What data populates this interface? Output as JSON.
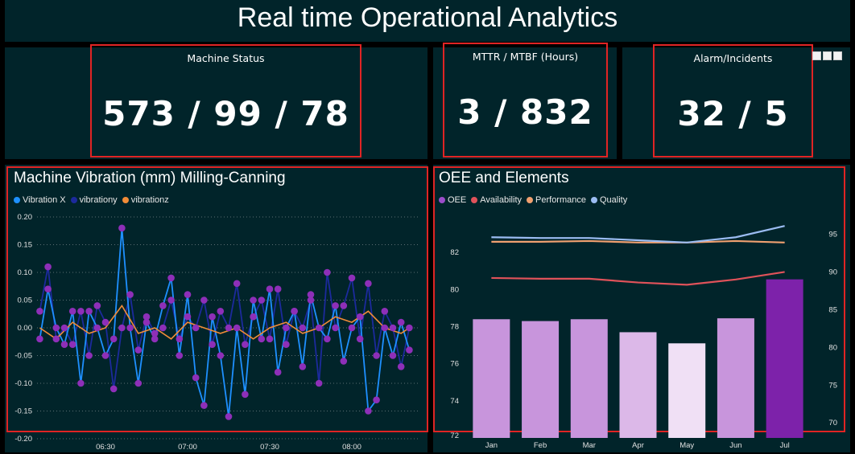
{
  "page_title": "Real time Operational Analytics",
  "kpis": [
    {
      "label": "Machine Status",
      "value": "573 / 99 / 78"
    },
    {
      "label": "MTTR / MTBF (Hours)",
      "value": "3 / 832"
    },
    {
      "label": "Alarm/Incidents",
      "value": "32 / 5"
    }
  ],
  "header_icons": [
    "filter-icon",
    "focus-mode-icon",
    "more-options-icon"
  ],
  "chart_data": [
    {
      "type": "line",
      "title": "Machine Vibration (mm) Milling-Canning",
      "x_ticks": [
        "06:30",
        "07:00",
        "07:30",
        "08:00"
      ],
      "ylim": [
        -0.2,
        0.2
      ],
      "y_ticks": [
        -0.2,
        -0.15,
        -0.1,
        -0.05,
        0.0,
        0.05,
        0.1,
        0.15,
        0.2
      ],
      "y_tick_labels": [
        "-0.20",
        "-0.15",
        "-0.10",
        "-0.05",
        "0.00",
        "0.05",
        "0.10",
        "0.15",
        "0.20"
      ],
      "grid": true,
      "legend": "top-left",
      "x_range": [
        "06:05",
        "08:25"
      ],
      "series": [
        {
          "name": "Vibration X",
          "color": "#1e90ff",
          "x": [
            "06:06",
            "06:09",
            "06:12",
            "06:15",
            "06:18",
            "06:21",
            "06:24",
            "06:27",
            "06:30",
            "06:33",
            "06:36",
            "06:39",
            "06:42",
            "06:45",
            "06:48",
            "06:51",
            "06:54",
            "06:57",
            "07:00",
            "07:03",
            "07:06",
            "07:09",
            "07:12",
            "07:15",
            "07:18",
            "07:21",
            "07:24",
            "07:27",
            "07:30",
            "07:33",
            "07:36",
            "07:39",
            "07:42",
            "07:45",
            "07:48",
            "07:51",
            "07:54",
            "07:57",
            "08:00",
            "08:03",
            "08:06",
            "08:09",
            "08:12",
            "08:15",
            "08:18",
            "08:21"
          ],
          "values": [
            -0.02,
            0.07,
            0.0,
            -0.03,
            0.03,
            -0.1,
            0.03,
            0.0,
            -0.05,
            -0.02,
            0.18,
            0.0,
            -0.1,
            0.01,
            -0.02,
            0.04,
            0.09,
            -0.05,
            0.06,
            -0.09,
            -0.14,
            0.02,
            -0.05,
            -0.16,
            0.0,
            -0.12,
            0.05,
            -0.02,
            0.07,
            -0.08,
            0.0,
            0.03,
            -0.07,
            0.06,
            0.0,
            -0.02,
            0.04,
            -0.06,
            0.0,
            0.02,
            -0.15,
            -0.13,
            0.0,
            -0.05,
            0.01,
            -0.04
          ]
        },
        {
          "name": "vibrationy",
          "color": "#1c2a9c",
          "x": [
            "06:06",
            "06:09",
            "06:12",
            "06:15",
            "06:18",
            "06:21",
            "06:24",
            "06:27",
            "06:30",
            "06:33",
            "06:36",
            "06:39",
            "06:42",
            "06:45",
            "06:48",
            "06:51",
            "06:54",
            "06:57",
            "07:00",
            "07:03",
            "07:06",
            "07:09",
            "07:12",
            "07:15",
            "07:18",
            "07:21",
            "07:24",
            "07:27",
            "07:30",
            "07:33",
            "07:36",
            "07:39",
            "07:42",
            "07:45",
            "07:48",
            "07:51",
            "07:54",
            "07:57",
            "08:00",
            "08:03",
            "08:06",
            "08:09",
            "08:12",
            "08:15",
            "08:18",
            "08:21"
          ],
          "values": [
            0.03,
            0.11,
            -0.02,
            0.0,
            -0.03,
            0.03,
            -0.05,
            0.04,
            0.01,
            -0.11,
            0.0,
            0.06,
            -0.04,
            0.02,
            -0.01,
            0.0,
            0.05,
            -0.02,
            0.02,
            0.0,
            0.05,
            -0.03,
            0.03,
            0.0,
            0.08,
            -0.03,
            0.02,
            0.05,
            -0.02,
            0.07,
            -0.03,
            0.03,
            0.0,
            0.05,
            -0.1,
            0.1,
            0.0,
            0.04,
            0.09,
            -0.02,
            0.08,
            -0.05,
            0.03,
            0.0,
            -0.07,
            0.0
          ]
        },
        {
          "name": "vibrationz",
          "color": "#f28c38",
          "x": [
            "06:06",
            "06:12",
            "06:18",
            "06:24",
            "06:30",
            "06:36",
            "06:42",
            "06:48",
            "06:54",
            "07:00",
            "07:06",
            "07:12",
            "07:18",
            "07:24",
            "07:30",
            "07:36",
            "07:42",
            "07:48",
            "07:54",
            "08:00",
            "08:06",
            "08:12",
            "08:18",
            "08:21"
          ],
          "values": [
            0.0,
            -0.02,
            0.01,
            -0.01,
            0.0,
            0.04,
            -0.01,
            0.0,
            -0.02,
            0.01,
            0.0,
            -0.01,
            0.0,
            -0.02,
            0.0,
            0.01,
            -0.01,
            0.0,
            0.02,
            0.01,
            0.03,
            0.0,
            -0.01,
            0.0
          ]
        }
      ]
    },
    {
      "type": "bar",
      "title": "OEE and Elements",
      "categories": [
        "Jan",
        "Feb",
        "Mar",
        "Apr",
        "May",
        "Jun",
        "Jul"
      ],
      "legend": "top-left",
      "grid": false,
      "ylim": [
        72,
        84
      ],
      "y_ticks": [
        74,
        76,
        78,
        80,
        82
      ],
      "y2lim": [
        68,
        97.5
      ],
      "y2_ticks": [
        70,
        75,
        80,
        85,
        90,
        95
      ],
      "series": [
        {
          "name": "OEE",
          "axis": "left",
          "kind": "bar",
          "color": "#9b4dca",
          "values": [
            78.4,
            78.3,
            78.4,
            77.7,
            77.1,
            78.45,
            80.55
          ],
          "bar_colors": [
            "#c895dc",
            "#c895dc",
            "#c895dc",
            "#dcb8e8",
            "#f0e0f5",
            "#c895dc",
            "#7d22aa"
          ]
        },
        {
          "name": "Availability",
          "axis": "right",
          "kind": "line",
          "color": "#e0525a",
          "values": [
            89.2,
            89.1,
            89.1,
            88.6,
            88.3,
            89.0,
            90.0
          ]
        },
        {
          "name": "Performance",
          "axis": "right",
          "kind": "line",
          "color": "#f0a070",
          "values": [
            94.0,
            94.0,
            94.1,
            93.9,
            93.9,
            94.1,
            93.9
          ]
        },
        {
          "name": "Quality",
          "axis": "right",
          "kind": "line",
          "color": "#9bbcf2",
          "values": [
            94.6,
            94.5,
            94.5,
            94.2,
            93.9,
            94.6,
            96.1
          ]
        }
      ]
    }
  ]
}
